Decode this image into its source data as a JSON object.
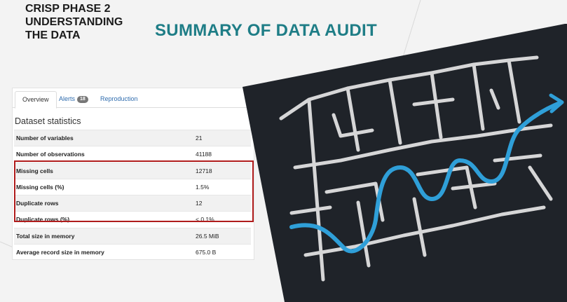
{
  "slide": {
    "heading": "CRISP PHASE 2\nUNDERSTANDING\nTHE DATA",
    "title": "SUMMARY OF DATA AUDIT"
  },
  "report": {
    "tabs": [
      {
        "label": "Overview",
        "active": true
      },
      {
        "label": "Alerts",
        "badge": "18"
      },
      {
        "label": "Reproduction"
      }
    ],
    "section_title": "Dataset statistics",
    "rows": [
      {
        "label": "Number of variables",
        "value": "21"
      },
      {
        "label": "Number of observations",
        "value": "41188"
      },
      {
        "label": "Missing cells",
        "value": "12718"
      },
      {
        "label": "Missing cells (%)",
        "value": "1.5%"
      },
      {
        "label": "Duplicate rows",
        "value": "12"
      },
      {
        "label": "Duplicate rows (%)",
        "value": "< 0.1%"
      },
      {
        "label": "Total size in memory",
        "value": "26.5 MiB"
      },
      {
        "label": "Average record size in memory",
        "value": "675.0 B"
      }
    ],
    "highlight_color": "#b01c1c"
  },
  "colors": {
    "title_teal": "#1e7d86",
    "maze_background": "#1f2329",
    "maze_chalk": "#e6e6e6",
    "maze_path": "#2f9fd8"
  },
  "image": {
    "subject": "chalk-maze-with-blue-path"
  }
}
